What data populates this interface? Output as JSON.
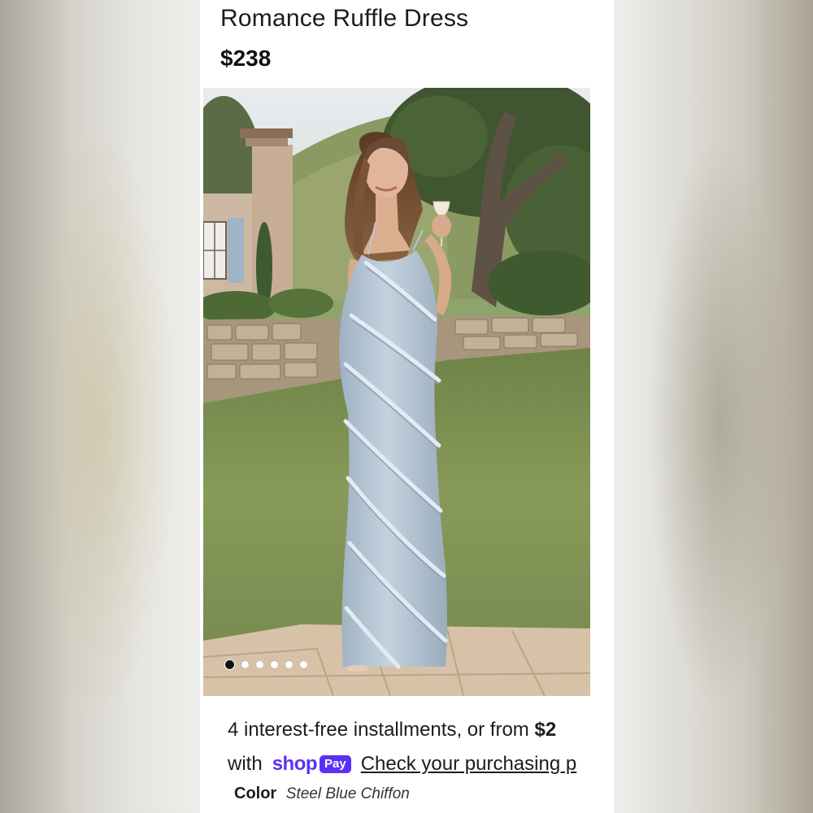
{
  "product": {
    "title": "Romance Ruffle Dress",
    "price": "$238"
  },
  "gallery": {
    "image_description": "model-in-steel-blue-ruffle-gown",
    "total_images": 6,
    "active_index": 0
  },
  "payment": {
    "installments_text": "4 interest-free installments, or from ",
    "installments_amount": "$2",
    "with_text": "with",
    "shop_word": "shop",
    "pay_badge": "Pay",
    "check_link": "Check your purchasing p"
  },
  "variant": {
    "color_label": "Color",
    "color_value": "Steel Blue Chiffon"
  },
  "colors": {
    "shop_pay_purple": "#5a31f4",
    "dress_blue": "#aebfd0"
  }
}
